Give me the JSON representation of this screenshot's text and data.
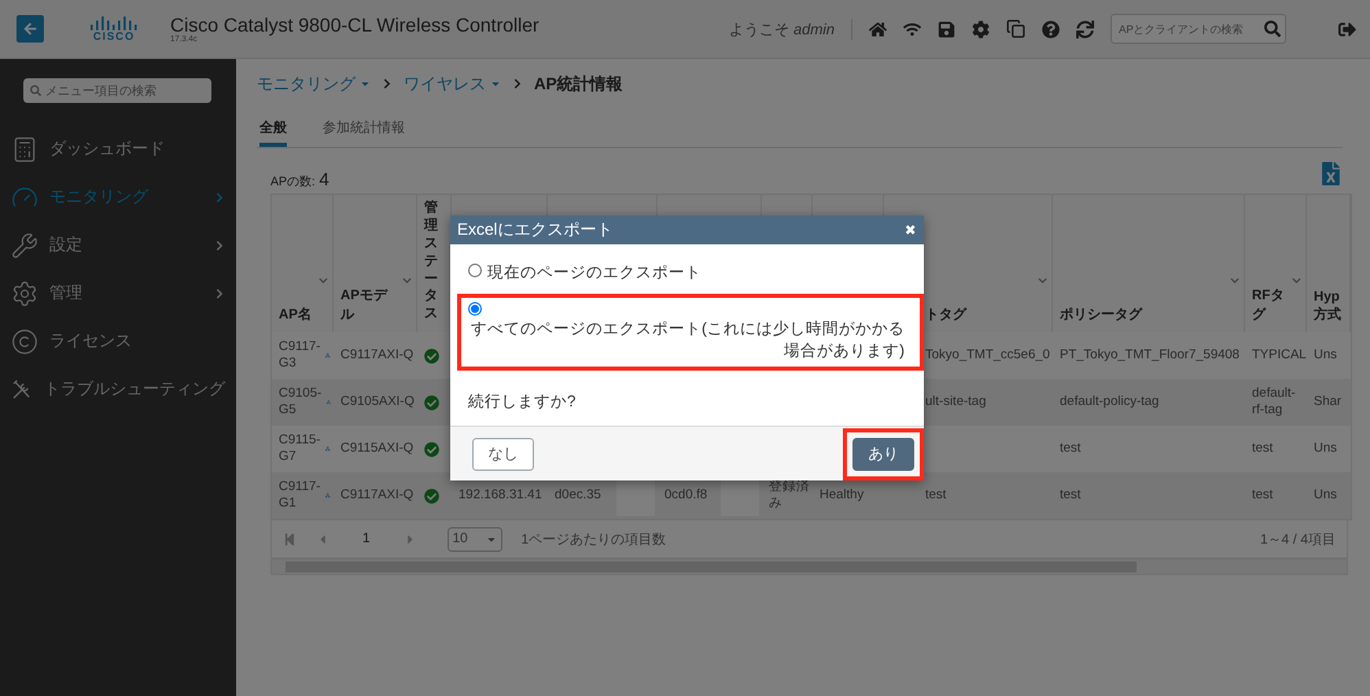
{
  "header": {
    "logo_text": "CISCO",
    "title": "Cisco Catalyst 9800-CL Wireless Controller",
    "version": "17.3.4c",
    "welcome": "ようこそ *admin*",
    "search": {
      "placeholder": "APとクライアントの検索"
    }
  },
  "sidebar": {
    "search": {
      "placeholder": "メニュー項目の検索"
    },
    "items": [
      {
        "label": "ダッシュボード",
        "selected": false,
        "has_submenu": false
      },
      {
        "label": "モニタリング",
        "selected": true,
        "has_submenu": true
      },
      {
        "label": "設定",
        "selected": false,
        "has_submenu": true
      },
      {
        "label": "管理",
        "selected": false,
        "has_submenu": true
      },
      {
        "label": "ライセンス",
        "selected": false,
        "has_submenu": false
      },
      {
        "label": "トラブルシューティング",
        "selected": false,
        "has_submenu": false
      }
    ]
  },
  "breadcrumb": [
    {
      "label": "モニタリング",
      "dropdown": true,
      "current": false
    },
    {
      "label": "ワイヤレス",
      "dropdown": true,
      "current": false
    },
    {
      "label": "AP統計情報",
      "dropdown": false,
      "current": true
    }
  ],
  "tabs": [
    {
      "label": "全般",
      "selected": true
    },
    {
      "label": "参加統計情報",
      "selected": false
    }
  ],
  "ap_count": {
    "label": "APの数:",
    "value": "4"
  },
  "table": {
    "columns": [
      {
        "label": "AP名",
        "sortable": true
      },
      {
        "label": "APモデル",
        "sortable": true
      },
      {
        "label": "管理ステータス",
        "sortable": false
      },
      {
        "label": "トタグ",
        "sortable": true
      },
      {
        "label": "ポリシータグ",
        "sortable": true
      },
      {
        "label": "RFタグ",
        "sortable": true
      },
      {
        "label": "Hyp 方式",
        "sortable": false
      }
    ],
    "rows": [
      {
        "ap_name": "C9117-G3",
        "ap_model": "C9117AXI-Q",
        "admin_up": true,
        "site_tag": "Tokyo_TMT_cc5e6_0",
        "policy_tag": "PT_Tokyo_TMT_Floor7_59408",
        "rf_tag": "TYPICAL",
        "hyp": "Uns"
      },
      {
        "ap_name": "C9105-G5",
        "ap_model": "C9105AXI-Q",
        "admin_up": true,
        "site_tag": "ult-site-tag",
        "policy_tag": "default-policy-tag",
        "rf_tag": "default-rf-tag",
        "hyp": "Shar"
      },
      {
        "ap_name": "C9115-G7",
        "ap_model": "C9115AXI-Q",
        "admin_up": true,
        "policy_tag": "test",
        "rf_tag": "test",
        "hyp": "Uns"
      },
      {
        "ap_name": "C9117-G1",
        "ap_model": "C9117AXI-Q",
        "admin_up": true,
        "ip": "192.168.31.41",
        "radio_mac": {
          "text": "d0ec.35",
          "redacted": true
        },
        "eth_mac": {
          "text": "0cd0.f8",
          "redacted": true
        },
        "state": "登録済み",
        "health": "Healthy",
        "site_tag": "test",
        "policy_tag": "test",
        "rf_tag": "test",
        "hyp": "Uns"
      }
    ]
  },
  "pagination": {
    "page": "1",
    "page_size": "10",
    "page_size_label": "1ページあたりの項目数",
    "summary": "1～4 / 4項目"
  },
  "dialog": {
    "title": "Excelにエクスポート",
    "close": "✖",
    "options": [
      {
        "label": "現在のページのエクスポート",
        "selected": false,
        "highlighted": false
      },
      {
        "label": "すべてのページのエクスポート(これには少し時間がかかる場合があります)",
        "selected": true,
        "highlighted": true
      }
    ],
    "question": "続行しますか?",
    "buttons": [
      {
        "label": "なし",
        "kind": "secondary",
        "highlighted": false
      },
      {
        "label": "あり",
        "kind": "primary",
        "highlighted": true
      }
    ]
  }
}
